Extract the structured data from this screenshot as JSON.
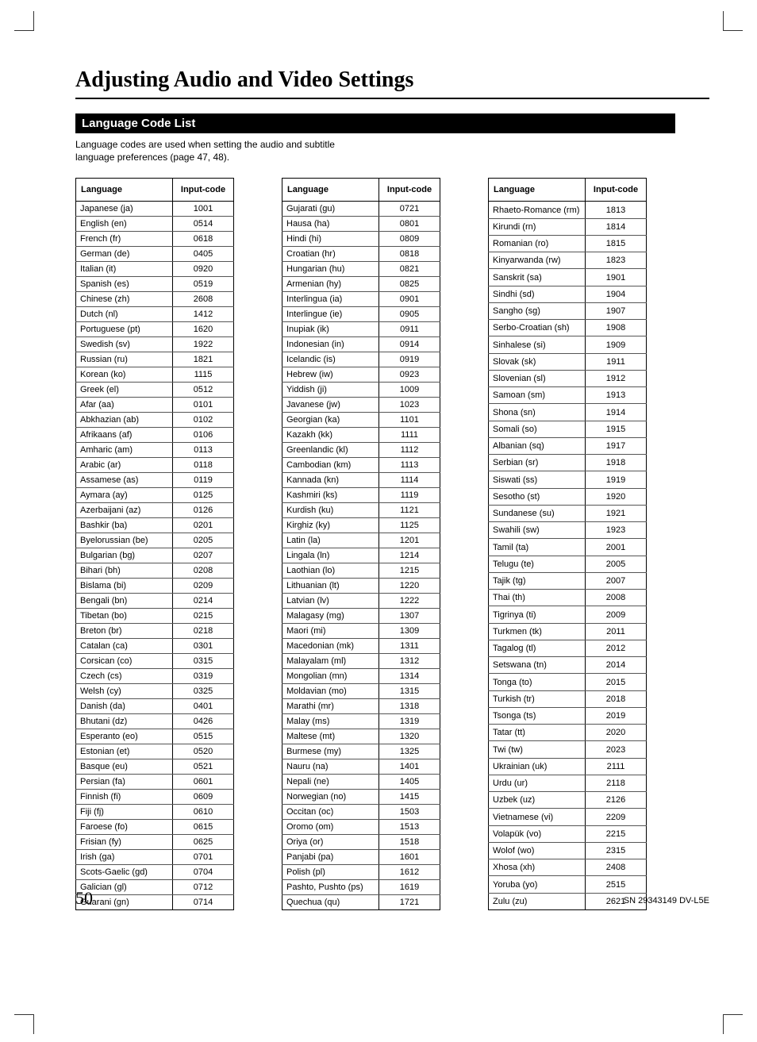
{
  "title": "Adjusting Audio and Video Settings",
  "section_bar": "Language Code List",
  "intro_line1": "Language codes are used when setting the audio and subtitle",
  "intro_line2": "language preferences (page 47, 48).",
  "headers": {
    "lang": "Language",
    "code": "Input-code"
  },
  "page_number": "50",
  "footer": "SN 29343149 DV-L5E",
  "col1": [
    {
      "l": "Japanese (ja)",
      "c": "1001"
    },
    {
      "l": "English (en)",
      "c": "0514"
    },
    {
      "l": "French (fr)",
      "c": "0618"
    },
    {
      "l": "German (de)",
      "c": "0405"
    },
    {
      "l": "Italian (it)",
      "c": "0920"
    },
    {
      "l": "Spanish (es)",
      "c": "0519"
    },
    {
      "l": "Chinese (zh)",
      "c": "2608"
    },
    {
      "l": "Dutch (nl)",
      "c": "1412"
    },
    {
      "l": "Portuguese (pt)",
      "c": "1620"
    },
    {
      "l": "Swedish (sv)",
      "c": "1922"
    },
    {
      "l": "Russian (ru)",
      "c": "1821"
    },
    {
      "l": "Korean (ko)",
      "c": "1115"
    },
    {
      "l": "Greek (el)",
      "c": "0512"
    },
    {
      "l": "Afar (aa)",
      "c": "0101"
    },
    {
      "l": "Abkhazian (ab)",
      "c": "0102"
    },
    {
      "l": "Afrikaans (af)",
      "c": "0106"
    },
    {
      "l": "Amharic (am)",
      "c": "0113"
    },
    {
      "l": "Arabic (ar)",
      "c": "0118"
    },
    {
      "l": "Assamese (as)",
      "c": "0119"
    },
    {
      "l": "Aymara (ay)",
      "c": "0125"
    },
    {
      "l": "Azerbaijani (az)",
      "c": "0126"
    },
    {
      "l": "Bashkir (ba)",
      "c": "0201"
    },
    {
      "l": "Byelorussian (be)",
      "c": "0205"
    },
    {
      "l": "Bulgarian (bg)",
      "c": "0207"
    },
    {
      "l": "Bihari (bh)",
      "c": "0208"
    },
    {
      "l": "Bislama (bi)",
      "c": "0209"
    },
    {
      "l": "Bengali (bn)",
      "c": "0214"
    },
    {
      "l": "Tibetan (bo)",
      "c": "0215"
    },
    {
      "l": "Breton (br)",
      "c": "0218"
    },
    {
      "l": "Catalan (ca)",
      "c": "0301"
    },
    {
      "l": "Corsican (co)",
      "c": "0315"
    },
    {
      "l": "Czech (cs)",
      "c": "0319"
    },
    {
      "l": "Welsh (cy)",
      "c": "0325"
    },
    {
      "l": "Danish (da)",
      "c": "0401"
    },
    {
      "l": "Bhutani (dz)",
      "c": "0426"
    },
    {
      "l": "Esperanto (eo)",
      "c": "0515"
    },
    {
      "l": "Estonian (et)",
      "c": "0520"
    },
    {
      "l": "Basque (eu)",
      "c": "0521"
    },
    {
      "l": "Persian (fa)",
      "c": "0601"
    },
    {
      "l": "Finnish (fi)",
      "c": "0609"
    },
    {
      "l": "Fiji (fj)",
      "c": "0610"
    },
    {
      "l": "Faroese (fo)",
      "c": "0615"
    },
    {
      "l": "Frisian (fy)",
      "c": "0625"
    },
    {
      "l": "Irish (ga)",
      "c": "0701"
    },
    {
      "l": "Scots-Gaelic (gd)",
      "c": "0704"
    },
    {
      "l": "Galician (gl)",
      "c": "0712"
    },
    {
      "l": "Guarani (gn)",
      "c": "0714"
    }
  ],
  "col2": [
    {
      "l": "Gujarati (gu)",
      "c": "0721"
    },
    {
      "l": "Hausa (ha)",
      "c": "0801"
    },
    {
      "l": "Hindi (hi)",
      "c": "0809"
    },
    {
      "l": "Croatian (hr)",
      "c": "0818"
    },
    {
      "l": "Hungarian (hu)",
      "c": "0821"
    },
    {
      "l": "Armenian (hy)",
      "c": "0825"
    },
    {
      "l": "Interlingua (ia)",
      "c": "0901"
    },
    {
      "l": "Interlingue (ie)",
      "c": "0905"
    },
    {
      "l": "Inupiak (ik)",
      "c": "0911"
    },
    {
      "l": "Indonesian (in)",
      "c": "0914"
    },
    {
      "l": "Icelandic (is)",
      "c": "0919"
    },
    {
      "l": "Hebrew (iw)",
      "c": "0923"
    },
    {
      "l": "Yiddish (ji)",
      "c": "1009"
    },
    {
      "l": "Javanese (jw)",
      "c": "1023"
    },
    {
      "l": "Georgian (ka)",
      "c": "1101"
    },
    {
      "l": "Kazakh (kk)",
      "c": "1111"
    },
    {
      "l": "Greenlandic (kl)",
      "c": "1112"
    },
    {
      "l": "Cambodian (km)",
      "c": "1113"
    },
    {
      "l": "Kannada (kn)",
      "c": "1114"
    },
    {
      "l": "Kashmiri (ks)",
      "c": "1119"
    },
    {
      "l": "Kurdish (ku)",
      "c": "1121"
    },
    {
      "l": "Kirghiz (ky)",
      "c": "1125"
    },
    {
      "l": "Latin (la)",
      "c": "1201"
    },
    {
      "l": "Lingala (ln)",
      "c": "1214"
    },
    {
      "l": "Laothian (lo)",
      "c": "1215"
    },
    {
      "l": "Lithuanian (lt)",
      "c": "1220"
    },
    {
      "l": "Latvian (lv)",
      "c": "1222"
    },
    {
      "l": "Malagasy (mg)",
      "c": "1307"
    },
    {
      "l": "Maori (mi)",
      "c": "1309"
    },
    {
      "l": "Macedonian (mk)",
      "c": "1311"
    },
    {
      "l": "Malayalam (ml)",
      "c": "1312"
    },
    {
      "l": "Mongolian (mn)",
      "c": "1314"
    },
    {
      "l": "Moldavian (mo)",
      "c": "1315"
    },
    {
      "l": "Marathi (mr)",
      "c": "1318"
    },
    {
      "l": "Malay (ms)",
      "c": "1319"
    },
    {
      "l": "Maltese (mt)",
      "c": "1320"
    },
    {
      "l": "Burmese (my)",
      "c": "1325"
    },
    {
      "l": "Nauru (na)",
      "c": "1401"
    },
    {
      "l": "Nepali (ne)",
      "c": "1405"
    },
    {
      "l": "Norwegian (no)",
      "c": "1415"
    },
    {
      "l": "Occitan (oc)",
      "c": "1503"
    },
    {
      "l": "Oromo (om)",
      "c": "1513"
    },
    {
      "l": "Oriya (or)",
      "c": "1518"
    },
    {
      "l": "Panjabi (pa)",
      "c": "1601"
    },
    {
      "l": "Polish (pl)",
      "c": "1612"
    },
    {
      "l": "Pashto, Pushto (ps)",
      "c": "1619"
    },
    {
      "l": "Quechua (qu)",
      "c": "1721"
    }
  ],
  "col3": [
    {
      "l": "Rhaeto-Romance (rm)",
      "c": "1813"
    },
    {
      "l": "Kirundi (rn)",
      "c": "1814"
    },
    {
      "l": "Romanian (ro)",
      "c": "1815"
    },
    {
      "l": "Kinyarwanda (rw)",
      "c": "1823"
    },
    {
      "l": "Sanskrit (sa)",
      "c": "1901"
    },
    {
      "l": "Sindhi (sd)",
      "c": "1904"
    },
    {
      "l": "Sangho (sg)",
      "c": "1907"
    },
    {
      "l": "Serbo-Croatian (sh)",
      "c": "1908"
    },
    {
      "l": "Sinhalese (si)",
      "c": "1909"
    },
    {
      "l": "Slovak (sk)",
      "c": "1911"
    },
    {
      "l": "Slovenian (sl)",
      "c": "1912"
    },
    {
      "l": "Samoan (sm)",
      "c": "1913"
    },
    {
      "l": "Shona (sn)",
      "c": "1914"
    },
    {
      "l": "Somali (so)",
      "c": "1915"
    },
    {
      "l": "Albanian (sq)",
      "c": "1917"
    },
    {
      "l": "Serbian (sr)",
      "c": "1918"
    },
    {
      "l": "Siswati (ss)",
      "c": "1919"
    },
    {
      "l": "Sesotho (st)",
      "c": "1920"
    },
    {
      "l": "Sundanese (su)",
      "c": "1921"
    },
    {
      "l": "Swahili (sw)",
      "c": "1923"
    },
    {
      "l": "Tamil (ta)",
      "c": "2001"
    },
    {
      "l": "Telugu (te)",
      "c": "2005"
    },
    {
      "l": "Tajik (tg)",
      "c": "2007"
    },
    {
      "l": "Thai (th)",
      "c": "2008"
    },
    {
      "l": "Tigrinya (ti)",
      "c": "2009"
    },
    {
      "l": "Turkmen (tk)",
      "c": "2011"
    },
    {
      "l": "Tagalog (tl)",
      "c": "2012"
    },
    {
      "l": "Setswana (tn)",
      "c": "2014"
    },
    {
      "l": "Tonga (to)",
      "c": "2015"
    },
    {
      "l": "Turkish (tr)",
      "c": "2018"
    },
    {
      "l": "Tsonga (ts)",
      "c": "2019"
    },
    {
      "l": "Tatar (tt)",
      "c": "2020"
    },
    {
      "l": "Twi (tw)",
      "c": "2023"
    },
    {
      "l": "Ukrainian (uk)",
      "c": "2111"
    },
    {
      "l": "Urdu (ur)",
      "c": "2118"
    },
    {
      "l": "Uzbek (uz)",
      "c": "2126"
    },
    {
      "l": "Vietnamese (vi)",
      "c": "2209"
    },
    {
      "l": "Volapük (vo)",
      "c": "2215"
    },
    {
      "l": "Wolof (wo)",
      "c": "2315"
    },
    {
      "l": "Xhosa (xh)",
      "c": "2408"
    },
    {
      "l": "Yoruba (yo)",
      "c": "2515"
    },
    {
      "l": "Zulu (zu)",
      "c": "2621"
    }
  ]
}
